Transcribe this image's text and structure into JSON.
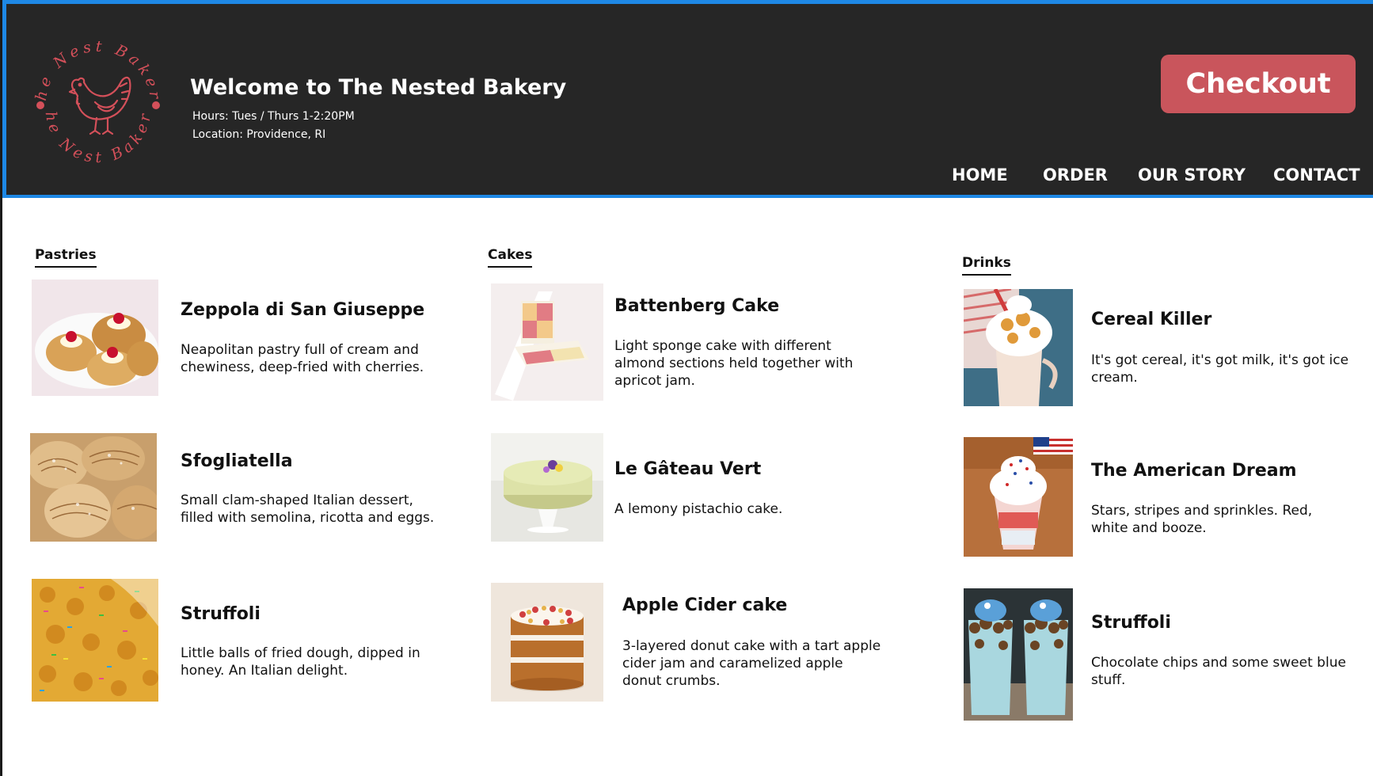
{
  "header": {
    "logo_ring_text": "The Nest Bakery",
    "title": "Welcome to The Nested Bakery",
    "hours": "Hours: Tues / Thurs 1-2:20PM",
    "location": "Location: Providence, RI",
    "checkout_label": "Checkout",
    "nav": [
      "HOME",
      "ORDER",
      "OUR STORY",
      "CONTACT"
    ],
    "colors": {
      "background": "#262626",
      "accent": "#1e88e5",
      "checkout": "#c9555c",
      "logo": "#d4505a"
    }
  },
  "menu": {
    "pastries": {
      "title": "Pastries",
      "items": [
        {
          "name": "Zeppola di San Giuseppe",
          "description": "Neapolitan pastry full of cream and chewiness, deep-fried with cherries."
        },
        {
          "name": "Sfogliatella",
          "description": "Small clam-shaped Italian dessert, filled with semolina, ricotta and eggs."
        },
        {
          "name": "Struffoli",
          "description": "Little balls of fried dough, dipped in honey. An Italian delight."
        }
      ]
    },
    "cakes": {
      "title": "Cakes",
      "items": [
        {
          "name": "Battenberg Cake",
          "description": "Light sponge cake with different almond sections held together with apricot jam."
        },
        {
          "name": "Le Gâteau Vert",
          "description": "A lemony pistachio cake."
        },
        {
          "name": "Apple Cider cake",
          "description": "3-layered donut cake with a tart apple cider jam  and caramelized apple donut crumbs."
        }
      ]
    },
    "drinks": {
      "title": "Drinks",
      "items": [
        {
          "name": "Cereal Killer",
          "description": "It's got cereal, it's got milk, it's got ice cream."
        },
        {
          "name": "The American Dream",
          "description": "Stars, stripes and sprinkles. Red, white and booze."
        },
        {
          "name": "Struffoli",
          "description": "Chocolate chips and some sweet blue stuff."
        }
      ]
    }
  }
}
